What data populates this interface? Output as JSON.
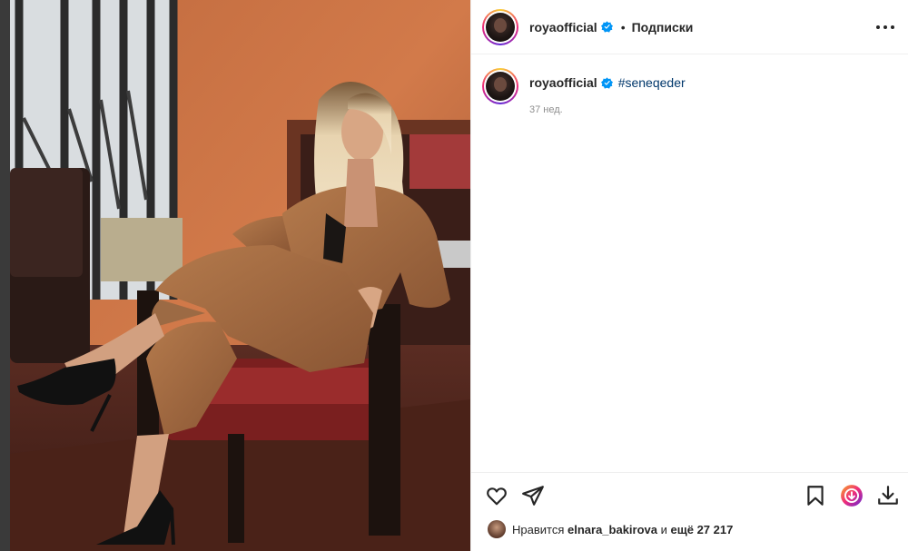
{
  "post": {
    "username": "royaofficial",
    "separator": "•",
    "follow_status": "Подписки",
    "caption_username": "royaofficial",
    "hashtag": "#seneqeder",
    "time_ago": "37 нед.",
    "likes_prefix": "Нравится",
    "likes_user": "elnara_bakirova",
    "likes_middle": "и",
    "likes_count": "ещё 27 217"
  },
  "colors": {
    "verified": "#0095f6",
    "link": "#00376b",
    "muted": "#8e8e8e"
  },
  "icons": {
    "more": "more-horizontal-icon",
    "like": "heart-icon",
    "share": "send-icon",
    "save": "bookmark-icon",
    "extension": "download-extension-icon",
    "download": "download-icon"
  }
}
